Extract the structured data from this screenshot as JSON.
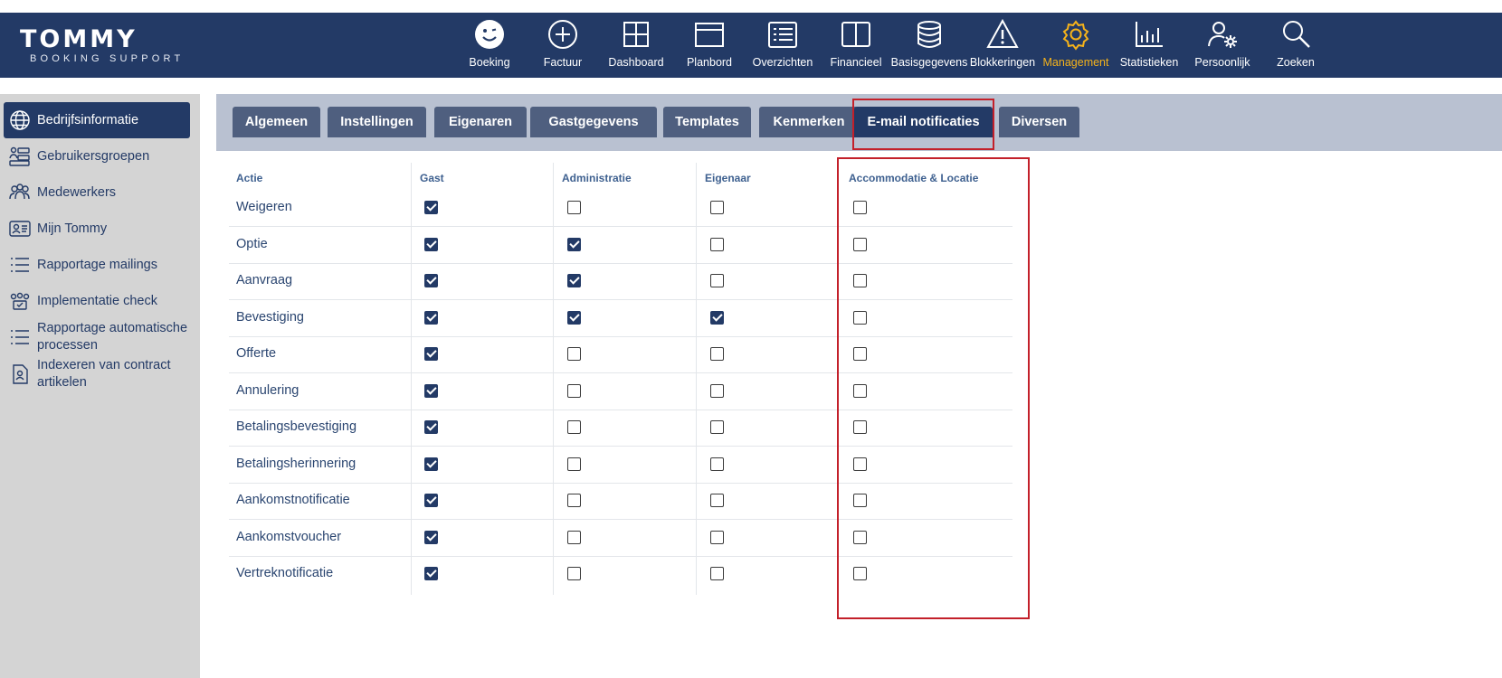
{
  "app": {
    "logo_main": "TOMMY",
    "logo_sub": "BOOKING SUPPORT"
  },
  "nav": [
    {
      "label": "Boeking",
      "icon": "smiley-icon",
      "active": false
    },
    {
      "label": "Factuur",
      "icon": "plus-circle-icon",
      "active": false
    },
    {
      "label": "Dashboard",
      "icon": "grid-icon",
      "active": false
    },
    {
      "label": "Planbord",
      "icon": "window-icon",
      "active": false
    },
    {
      "label": "Overzichten",
      "icon": "list-icon",
      "active": false
    },
    {
      "label": "Financieel",
      "icon": "book-icon",
      "active": false
    },
    {
      "label": "Basisgegevens",
      "icon": "database-icon",
      "active": false
    },
    {
      "label": "Blokkeringen",
      "icon": "warning-icon",
      "active": false
    },
    {
      "label": "Management",
      "icon": "gear-icon",
      "active": true
    },
    {
      "label": "Statistieken",
      "icon": "bar-chart-icon",
      "active": false
    },
    {
      "label": "Persoonlijk",
      "icon": "user-gear-icon",
      "active": false
    },
    {
      "label": "Zoeken",
      "icon": "search-icon",
      "active": false
    }
  ],
  "sidebar": [
    {
      "label": "Bedrijfsinformatie",
      "icon": "globe-icon",
      "active": true
    },
    {
      "label": "Gebruikersgroepen",
      "icon": "user-groups-icon",
      "active": false
    },
    {
      "label": "Medewerkers",
      "icon": "users-icon",
      "active": false
    },
    {
      "label": "Mijn Tommy",
      "icon": "id-card-icon",
      "active": false
    },
    {
      "label": "Rapportage mailings",
      "icon": "list-icon",
      "active": false
    },
    {
      "label": "Implementatie check",
      "icon": "team-check-icon",
      "active": false
    },
    {
      "label": "Rapportage automatische processen",
      "icon": "list-icon",
      "active": false
    },
    {
      "label": "Indexeren van contract artikelen",
      "icon": "contract-icon",
      "active": false
    }
  ],
  "tabs": [
    {
      "label": "Algemeen",
      "active": false
    },
    {
      "label": "Instellingen",
      "active": false
    },
    {
      "label": "Eigenaren",
      "active": false
    },
    {
      "label": "Gastgegevens",
      "active": false
    },
    {
      "label": "Templates",
      "active": false
    },
    {
      "label": "Kenmerken",
      "active": false
    },
    {
      "label": "E-mail notificaties",
      "active": true
    },
    {
      "label": "Diversen",
      "active": false
    }
  ],
  "table": {
    "headers": [
      "Actie",
      "Gast",
      "Administratie",
      "Eigenaar",
      "Accommodatie & Locatie"
    ],
    "rows": [
      {
        "action": "Weigeren",
        "gast": true,
        "administratie": false,
        "eigenaar": false,
        "accommodatie": false
      },
      {
        "action": "Optie",
        "gast": true,
        "administratie": true,
        "eigenaar": false,
        "accommodatie": false
      },
      {
        "action": "Aanvraag",
        "gast": true,
        "administratie": true,
        "eigenaar": false,
        "accommodatie": false
      },
      {
        "action": "Bevestiging",
        "gast": true,
        "administratie": true,
        "eigenaar": true,
        "accommodatie": false
      },
      {
        "action": "Offerte",
        "gast": true,
        "administratie": false,
        "eigenaar": false,
        "accommodatie": false
      },
      {
        "action": "Annulering",
        "gast": true,
        "administratie": false,
        "eigenaar": false,
        "accommodatie": false
      },
      {
        "action": "Betalingsbevestiging",
        "gast": true,
        "administratie": false,
        "eigenaar": false,
        "accommodatie": false
      },
      {
        "action": "Betalingsherinnering",
        "gast": true,
        "administratie": false,
        "eigenaar": false,
        "accommodatie": false
      },
      {
        "action": "Aankomstnotificatie",
        "gast": true,
        "administratie": false,
        "eigenaar": false,
        "accommodatie": false
      },
      {
        "action": "Aankomstvoucher",
        "gast": true,
        "administratie": false,
        "eigenaar": false,
        "accommodatie": false
      },
      {
        "action": "Vertreknotificatie",
        "gast": true,
        "administratie": false,
        "eigenaar": false,
        "accommodatie": false
      }
    ]
  },
  "colors": {
    "header_bg": "#233a66",
    "accent": "#f6b31a",
    "tab_bg": "#4f5f7f",
    "highlight": "#c3202a"
  }
}
